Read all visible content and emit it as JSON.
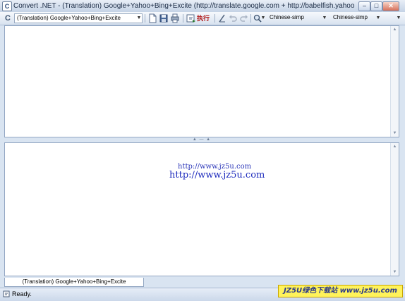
{
  "window": {
    "title": "Convert .NET - (Translation) Google+Yahoo+Bing+Excite (http://translate.google.com + http://babelfish.yahoo.co...",
    "app_icon_glyph": "C",
    "min_glyph": "‒",
    "max_glyph": "□",
    "close_glyph": "✕"
  },
  "toolbar": {
    "left_icon_glyph": "C",
    "engine_select_value": "(Translation) Google+Yahoo+Bing+Excite",
    "exec_label": "执行",
    "source_lang_value": "Chinese-simp",
    "target_lang_value": "Chinese-simp",
    "dropdown_glyph": "▼"
  },
  "result_pane": {
    "url_small": "http://www.jz5u.com",
    "url_large": "http://www.jz5u.com"
  },
  "tabs": [
    {
      "label": "(Translation) Google+Yahoo+Bing+Excite",
      "active": true
    }
  ],
  "status": {
    "text": "Ready."
  },
  "watermark": {
    "text": "JZ5U绿色下载站 www.jz5u.com"
  },
  "colors": {
    "exec_text": "#b01818",
    "url_text": "#1d2bbd",
    "watermark_bg": "#fff35a"
  }
}
